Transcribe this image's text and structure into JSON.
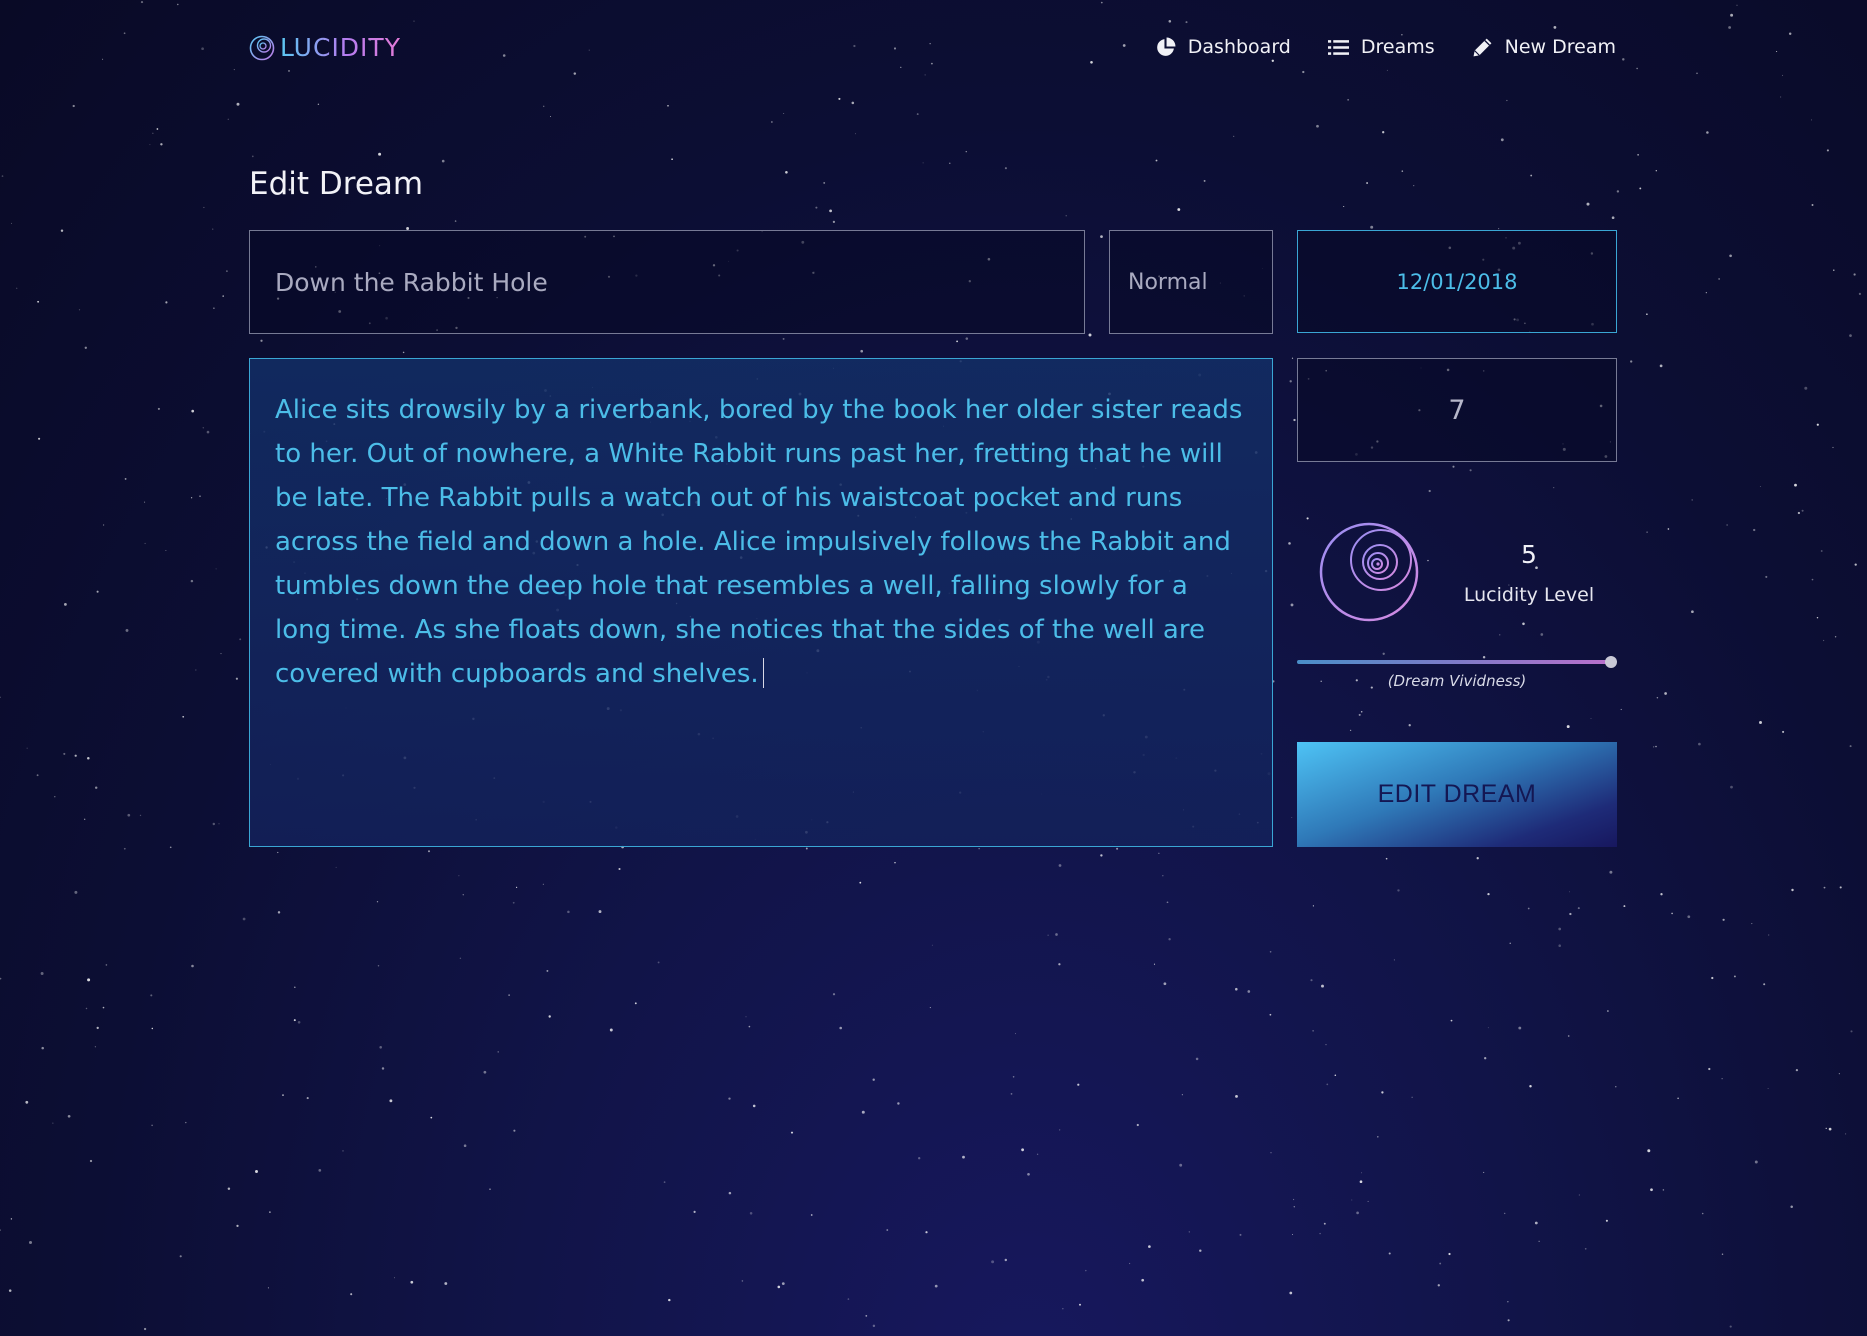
{
  "app": {
    "name": "LUCIDITY",
    "logo_icon": "spiral-logo-icon",
    "accent_gradient": [
      "#5ac8f2",
      "#b67cf0",
      "#e37bd6"
    ]
  },
  "nav": {
    "items": [
      {
        "label": "Dashboard",
        "icon": "pie-chart-icon"
      },
      {
        "label": "Dreams",
        "icon": "list-icon"
      },
      {
        "label": "New Dream",
        "icon": "pencil-icon"
      }
    ]
  },
  "page": {
    "title": "Edit Dream"
  },
  "form": {
    "title_value": "Down the Rabbit Hole",
    "dream_type": "Normal",
    "date": "12/01/2018",
    "vividness_value": "7",
    "description": "Alice sits drowsily by a riverbank, bored by the book her older sister reads to her. Out of nowhere, a White Rabbit runs past her, fretting that he will be late. The Rabbit pulls a watch out of his waistcoat pocket and runs across the field and down a hole. Alice impulsively follows the Rabbit and tumbles down the deep hole that resembles a well, falling slowly for a long time. As she floats down, she notices that the sides of the well are covered with cupboards and shelves.",
    "lucidity": {
      "value": "5",
      "label": "Lucidity Level",
      "icon": "spiral-icon"
    },
    "vividness_slider": {
      "fraction": 0.98,
      "caption": "(Dream Vividness)"
    },
    "submit_label": "EDIT DREAM"
  },
  "colors": {
    "background": "#0c0e34",
    "input_accent": "#3aa6d4",
    "text_accent": "#4cbde8"
  }
}
